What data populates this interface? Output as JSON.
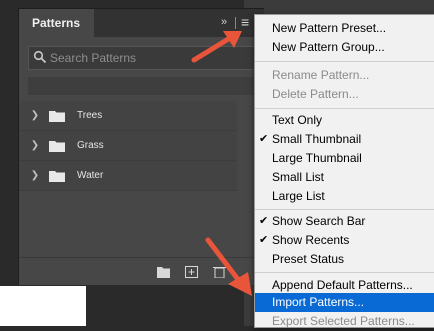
{
  "panel": {
    "tab_title": "Patterns",
    "collapse_glyph": "»",
    "menu_glyph": "≡",
    "search": {
      "placeholder": "Search Patterns",
      "value": ""
    },
    "groups": [
      {
        "label": "Trees",
        "expanded": false
      },
      {
        "label": "Grass",
        "expanded": false
      },
      {
        "label": "Water",
        "expanded": false
      }
    ],
    "bottom_actions": [
      "new-group-icon",
      "new-pattern-icon",
      "delete-icon"
    ]
  },
  "menu": {
    "items": [
      {
        "label": "New Pattern Preset...",
        "state": "enabled",
        "checked": false
      },
      {
        "label": "New Pattern Group...",
        "state": "enabled",
        "checked": false
      },
      {
        "label": "Rename Pattern...",
        "state": "disabled",
        "checked": false
      },
      {
        "label": "Delete Pattern...",
        "state": "disabled",
        "checked": false
      },
      {
        "label": "Text Only",
        "state": "enabled",
        "checked": false
      },
      {
        "label": "Small Thumbnail",
        "state": "enabled",
        "checked": true
      },
      {
        "label": "Large Thumbnail",
        "state": "enabled",
        "checked": false
      },
      {
        "label": "Small List",
        "state": "enabled",
        "checked": false
      },
      {
        "label": "Large List",
        "state": "enabled",
        "checked": false
      },
      {
        "label": "Show Search Bar",
        "state": "enabled",
        "checked": true
      },
      {
        "label": "Show Recents",
        "state": "enabled",
        "checked": true
      },
      {
        "label": "Preset Status",
        "state": "enabled",
        "checked": false
      },
      {
        "label": "Append Default Patterns...",
        "state": "enabled",
        "checked": false
      },
      {
        "label": "Import Patterns...",
        "state": "highlighted",
        "checked": false
      },
      {
        "label": "Export Selected Patterns...",
        "state": "disabled",
        "checked": false
      }
    ],
    "check_glyph": "✔"
  },
  "colors": {
    "highlight": "#0a6ad5",
    "arrow": "#e8553b",
    "panel_bg": "#474747"
  }
}
